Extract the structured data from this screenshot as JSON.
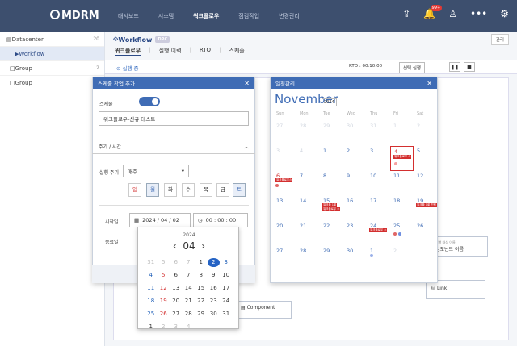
{
  "topbar": {
    "logo": "MDRM",
    "nav": [
      "대시보드",
      "시스템",
      "워크플로우",
      "점검작업",
      "변경관리"
    ],
    "active": "워크플로우",
    "bell_badge": "99+"
  },
  "sidebar": {
    "items": [
      {
        "label": "Datacenter",
        "count": "20"
      },
      {
        "label": "Workflow",
        "count": ""
      },
      {
        "label": "Group",
        "count": "2"
      },
      {
        "label": "Group",
        "count": "1"
      }
    ]
  },
  "main": {
    "title": "Workflow",
    "tag": "DRC",
    "manage": "관리",
    "subtabs": [
      "워크플로우",
      "실행 이력",
      "RTO",
      "스케줄"
    ],
    "run": "실행 중",
    "rto": "RTO : 00:10:00",
    "sel_run": "선택 실행"
  },
  "nodes": {
    "target_small": "실행 대상 이름",
    "component": "Component",
    "target_name": "컴포넌트 이름",
    "link": "Link"
  },
  "dialog1": {
    "title": "스케줄 작업 추가",
    "schedule_label": "스케줄",
    "name": "워크플로우-신규 테스트",
    "period_section": "주기 / 시간",
    "cycle_label": "실행 주기",
    "cycle_value": "매주",
    "days": [
      "일",
      "월",
      "화",
      "수",
      "목",
      "금",
      "토"
    ],
    "start_label": "시작일",
    "start_date": "2024 / 04 / 02",
    "start_time": "00 : 00 : 00",
    "end_label": "종료일"
  },
  "datepicker": {
    "year": "2024",
    "month": "04",
    "grid": [
      "31",
      "1",
      "2",
      "3",
      "4",
      "5",
      "6",
      "7",
      "8",
      "9",
      "10",
      "11",
      "12",
      "13",
      "14",
      "15",
      "16",
      "17",
      "18",
      "19",
      "20",
      "21",
      "22",
      "23",
      "24",
      "25",
      "26",
      "27",
      "28",
      "29",
      "30",
      "31",
      "1"
    ]
  },
  "dialog2": {
    "title": "일정관리",
    "month": "November",
    "year": "2024",
    "weekdays": [
      "Sun",
      "Mon",
      "Tue",
      "Wed",
      "Thu",
      "Fri",
      "Sat"
    ],
    "cells": [
      "27",
      "28",
      "29",
      "30",
      "31",
      "1",
      "2",
      "3",
      "4",
      "5",
      "6",
      "7",
      "8",
      "9",
      "10",
      "11",
      "12",
      "13",
      "14",
      "15",
      "16",
      "17",
      "18",
      "19",
      "20",
      "21",
      "22",
      "23",
      "24",
      "25",
      "26",
      "27",
      "28",
      "29",
      "30",
      "1",
      "2"
    ],
    "events": {
      "fri4": "워크플로우 스",
      "mon6": "워크플로우스",
      "wed13a": "워크플 1회",
      "wed13b": "워크플로우 스",
      "fri19": "워크플 1회 진행",
      "thu24": "워크플로우 스"
    }
  }
}
